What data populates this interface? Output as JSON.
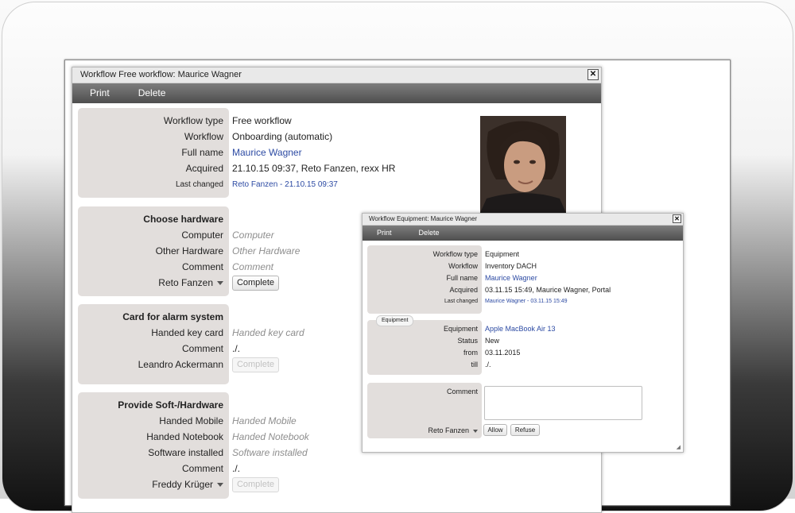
{
  "main_window": {
    "title": "Workflow Free workflow: Maurice Wagner",
    "close_label": "✕",
    "toolbar": {
      "print": "Print",
      "delete": "Delete"
    },
    "details": {
      "workflow_type_label": "Workflow type",
      "workflow_type": "Free workflow",
      "workflow_label": "Workflow",
      "workflow": "Onboarding (automatic)",
      "full_name_label": "Full name",
      "full_name": "Maurice Wagner",
      "acquired_label": "Acquired",
      "acquired": "21.10.15 09:37, Reto Fanzen, rexx HR",
      "last_changed_label": "Last changed",
      "last_changed": "Reto Fanzen - 21.10.15 09:37"
    },
    "hardware": {
      "title": "Choose hardware",
      "computer_label": "Computer",
      "computer_placeholder": "Computer",
      "other_label": "Other Hardware",
      "other_placeholder": "Other Hardware",
      "comment_label": "Comment",
      "comment_placeholder": "Comment",
      "assignee": "Reto Fanzen",
      "complete": "Complete"
    },
    "alarm": {
      "title": "Card for alarm system",
      "keycard_label": "Handed key card",
      "keycard_placeholder": "Handed key card",
      "comment_label": "Comment",
      "comment": "./.",
      "assignee": "Leandro Ackermann",
      "complete": "Complete"
    },
    "software": {
      "title": "Provide Soft-/Hardware",
      "mobile_label": "Handed Mobile",
      "mobile_placeholder": "Handed Mobile",
      "notebook_label": "Handed Notebook",
      "notebook_placeholder": "Handed Notebook",
      "software_label": "Software installed",
      "software_placeholder": "Software installed",
      "comment_label": "Comment",
      "comment": "./.",
      "assignee": "Freddy Krüger",
      "complete": "Complete"
    }
  },
  "equipment_window": {
    "title": "Workflow Equipment: Maurice Wagner",
    "close_label": "✕",
    "toolbar": {
      "print": "Print",
      "delete": "Delete"
    },
    "details": {
      "workflow_type_label": "Workflow type",
      "workflow_type": "Equipment",
      "workflow_label": "Workflow",
      "workflow": "Inventory DACH",
      "full_name_label": "Full name",
      "full_name": "Maurice Wagner",
      "acquired_label": "Acquired",
      "acquired": "03.11.15 15:49, Maurice Wagner, Portal",
      "last_changed_label": "Last changed",
      "last_changed": "Maurice Wagner - 03.11.15 15:49"
    },
    "equipment": {
      "tab": "Equipment",
      "equipment_label": "Equipment",
      "equipment": "Apple MacBook Air 13",
      "status_label": "Status",
      "status": "New",
      "from_label": "from",
      "from": "03.11.2015",
      "till_label": "till",
      "till": "./."
    },
    "approval": {
      "comment_label": "Comment",
      "assignee": "Reto Fanzen",
      "allow": "Allow",
      "refuse": "Refuse"
    }
  },
  "colors": {
    "panel": "#e2dedc",
    "link": "#2c4aa3",
    "toolbar": "#5e5e5e"
  }
}
